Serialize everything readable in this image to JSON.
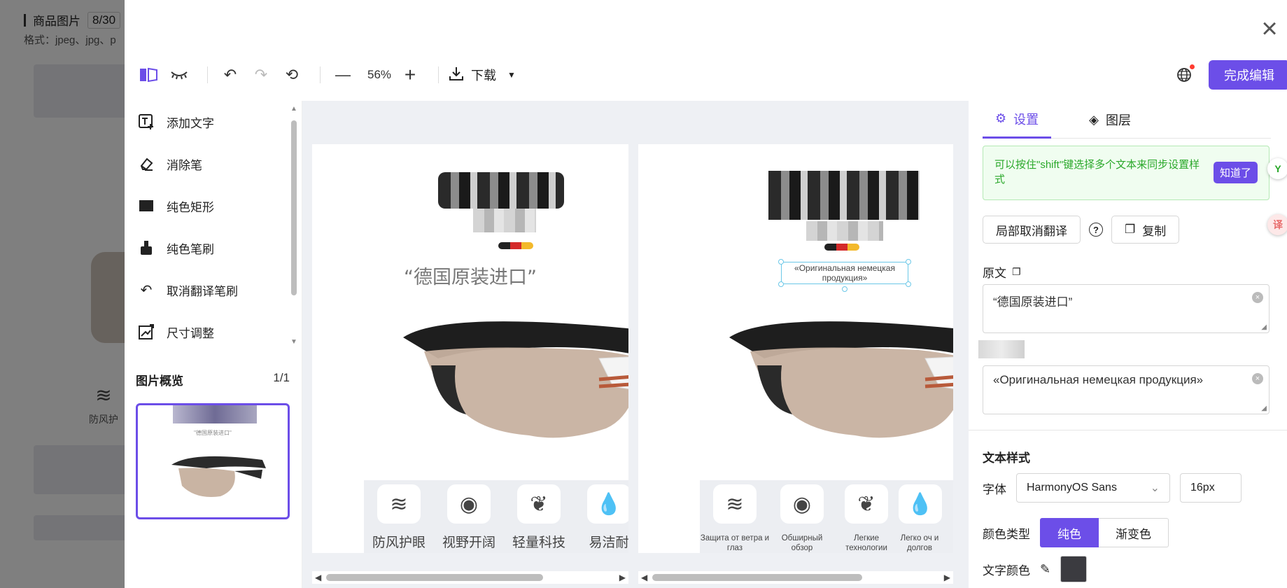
{
  "background_page": {
    "section_title": "商品图片",
    "count": "8/30",
    "format_hint": "格式：jpeg、jpg、p",
    "feature_label": "防风护"
  },
  "toolbar": {
    "zoom": "56%",
    "download_label": "下载",
    "finish_label": "完成编辑"
  },
  "tools": [
    {
      "label": "添加文字",
      "icon": "add-text-icon"
    },
    {
      "label": "消除笔",
      "icon": "eraser-icon"
    },
    {
      "label": "纯色矩形",
      "icon": "rectangle-icon"
    },
    {
      "label": "纯色笔刷",
      "icon": "brush-icon"
    },
    {
      "label": "取消翻译笔刷",
      "icon": "undo-translate-icon"
    },
    {
      "label": "尺寸调整",
      "icon": "resize-icon"
    }
  ],
  "preview": {
    "title": "图片概览",
    "count": "1/1",
    "caption": "\"德国原装进口\""
  },
  "canvas": {
    "original": {
      "slogan": "“德国原装进口”",
      "features": [
        "防风护眼",
        "视野开阔",
        "轻量科技",
        "易洁耐"
      ]
    },
    "translated": {
      "slogan_line1": "«Оригинальная немецкая",
      "slogan_line2": "продукция»",
      "features": [
        "Защита от ветра и глаз",
        "Обширный обзор",
        "Легкие технологии",
        "Легко оч и долгов"
      ]
    }
  },
  "right_panel": {
    "tabs": [
      "设置",
      "图层"
    ],
    "tip_text": "可以按住\"shift\"键选择多个文本来同步设置样式",
    "tip_button": "知道了",
    "partial_untranslate": "局部取消翻译",
    "copy_label": "复制",
    "source_label": "原文",
    "source_text": "“德国原装进口”",
    "translation_text": "«Оригинальная немецкая продукция»",
    "text_style_title": "文本样式",
    "font_label": "字体",
    "font_value": "HarmonyOS Sans",
    "font_size": "16px",
    "color_type_label": "颜色类型",
    "color_type_options": [
      "纯色",
      "渐变色"
    ],
    "text_color_label": "文字颜色"
  },
  "colors": {
    "accent": "#6c4ee8",
    "tip_green": "#2aa82a",
    "text_color": "#3b3b40"
  }
}
